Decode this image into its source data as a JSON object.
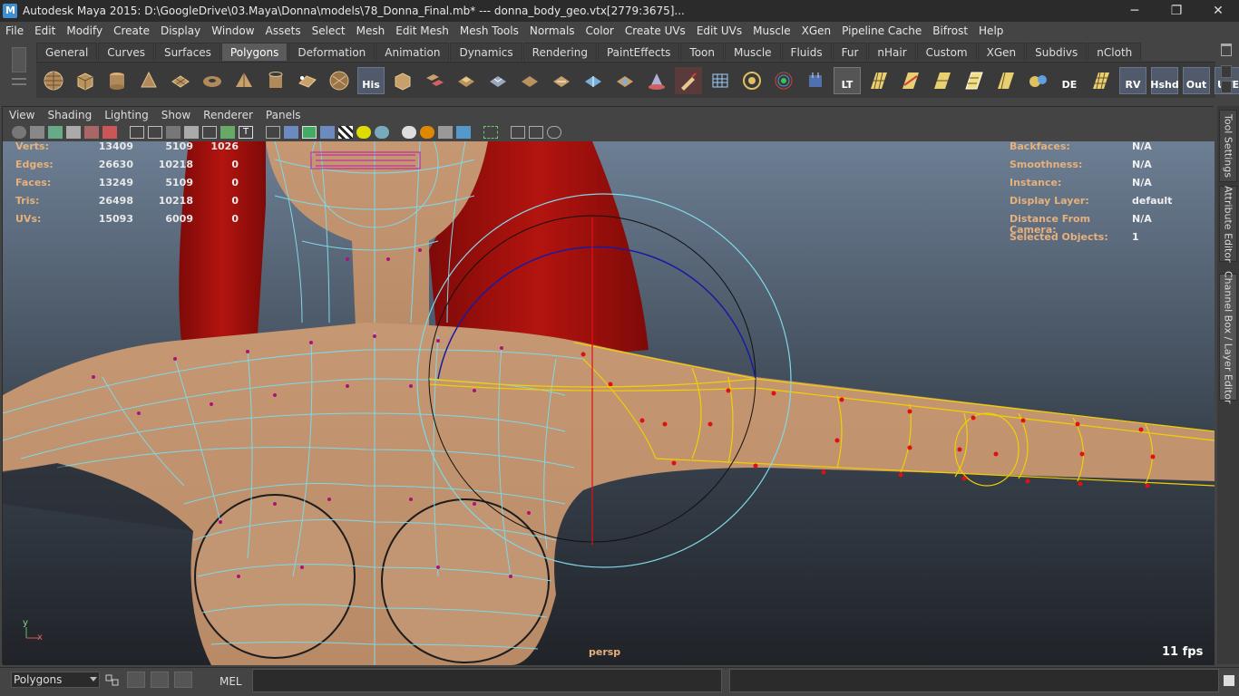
{
  "window": {
    "title": "Autodesk Maya 2015: D:\\GoogleDrive\\03.Maya\\Donna\\models\\78_Donna_Final.mb*   ---   donna_body_geo.vtx[2779:3675]...",
    "minimize": "─",
    "maximize": "❐",
    "close": "✕"
  },
  "menu": [
    "File",
    "Edit",
    "Modify",
    "Create",
    "Display",
    "Window",
    "Assets",
    "Select",
    "Mesh",
    "Edit Mesh",
    "Mesh Tools",
    "Normals",
    "Color",
    "Create UVs",
    "Edit UVs",
    "Muscle",
    "XGen",
    "Pipeline Cache",
    "Bifrost",
    "Help"
  ],
  "shelf": {
    "tabs": [
      "General",
      "Curves",
      "Surfaces",
      "Polygons",
      "Deformation",
      "Animation",
      "Dynamics",
      "Rendering",
      "PaintEffects",
      "Toon",
      "Muscle",
      "Fluids",
      "Fur",
      "nHair",
      "Custom",
      "XGen",
      "Subdivs",
      "nCloth"
    ],
    "active_tab": "Polygons",
    "text_buttons": {
      "his": "His",
      "lt": "LT",
      "de": "DE",
      "rv": "RV",
      "hshd": "Hshd",
      "out": "Out",
      "ute": "UTE"
    }
  },
  "panel_menu": [
    "View",
    "Shading",
    "Lighting",
    "Show",
    "Renderer",
    "Panels"
  ],
  "hud": {
    "stats": [
      {
        "label": "Verts:",
        "v1": "13409",
        "v2": "5109",
        "v3": "1026"
      },
      {
        "label": "Edges:",
        "v1": "26630",
        "v2": "10218",
        "v3": "0"
      },
      {
        "label": "Faces:",
        "v1": "13249",
        "v2": "5109",
        "v3": "0"
      },
      {
        "label": "Tris:",
        "v1": "26498",
        "v2": "10218",
        "v3": "0"
      },
      {
        "label": "UVs:",
        "v1": "15093",
        "v2": "6009",
        "v3": "0"
      }
    ],
    "info": [
      {
        "label": "Backfaces:",
        "value": "N/A"
      },
      {
        "label": "Smoothness:",
        "value": "N/A"
      },
      {
        "label": "Instance:",
        "value": "N/A"
      },
      {
        "label": "Display Layer:",
        "value": "default"
      },
      {
        "label": "Distance From Camera:",
        "value": "N/A"
      },
      {
        "label": "Selected Objects:",
        "value": "1"
      }
    ],
    "camera": "persp",
    "fps": "11 fps",
    "axis_y": "y",
    "axis_x": "x"
  },
  "side_tabs": [
    "Tool Settings",
    "Attribute Editor",
    "Channel Box / Layer Editor"
  ],
  "command_line": {
    "mode": "Polygons",
    "language": "MEL"
  },
  "colors": {
    "hud_label": "#e8b07a",
    "hair": "#a8120f",
    "skin": "#c89a73",
    "wireframe": "#7fd8e8",
    "selection": "#f0d000",
    "vertex": "#b0107a"
  }
}
